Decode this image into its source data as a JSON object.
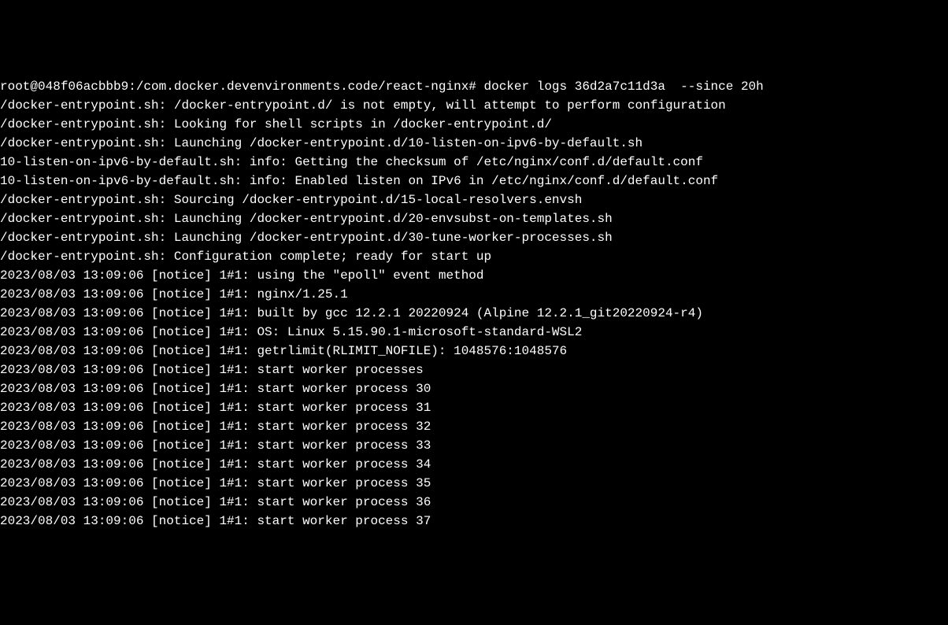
{
  "terminal": {
    "prompt": "root@048f06acbbb9:/com.docker.devenvironments.code/react-nginx# ",
    "command": "docker logs 36d2a7c11d3a  --since 20h",
    "lines": [
      "/docker-entrypoint.sh: /docker-entrypoint.d/ is not empty, will attempt to perform configuration",
      "/docker-entrypoint.sh: Looking for shell scripts in /docker-entrypoint.d/",
      "/docker-entrypoint.sh: Launching /docker-entrypoint.d/10-listen-on-ipv6-by-default.sh",
      "10-listen-on-ipv6-by-default.sh: info: Getting the checksum of /etc/nginx/conf.d/default.conf",
      "10-listen-on-ipv6-by-default.sh: info: Enabled listen on IPv6 in /etc/nginx/conf.d/default.conf",
      "/docker-entrypoint.sh: Sourcing /docker-entrypoint.d/15-local-resolvers.envsh",
      "/docker-entrypoint.sh: Launching /docker-entrypoint.d/20-envsubst-on-templates.sh",
      "/docker-entrypoint.sh: Launching /docker-entrypoint.d/30-tune-worker-processes.sh",
      "/docker-entrypoint.sh: Configuration complete; ready for start up",
      "2023/08/03 13:09:06 [notice] 1#1: using the \"epoll\" event method",
      "2023/08/03 13:09:06 [notice] 1#1: nginx/1.25.1",
      "2023/08/03 13:09:06 [notice] 1#1: built by gcc 12.2.1 20220924 (Alpine 12.2.1_git20220924-r4)",
      "2023/08/03 13:09:06 [notice] 1#1: OS: Linux 5.15.90.1-microsoft-standard-WSL2",
      "2023/08/03 13:09:06 [notice] 1#1: getrlimit(RLIMIT_NOFILE): 1048576:1048576",
      "2023/08/03 13:09:06 [notice] 1#1: start worker processes",
      "2023/08/03 13:09:06 [notice] 1#1: start worker process 30",
      "2023/08/03 13:09:06 [notice] 1#1: start worker process 31",
      "2023/08/03 13:09:06 [notice] 1#1: start worker process 32",
      "2023/08/03 13:09:06 [notice] 1#1: start worker process 33",
      "2023/08/03 13:09:06 [notice] 1#1: start worker process 34",
      "2023/08/03 13:09:06 [notice] 1#1: start worker process 35",
      "2023/08/03 13:09:06 [notice] 1#1: start worker process 36",
      "2023/08/03 13:09:06 [notice] 1#1: start worker process 37"
    ]
  }
}
